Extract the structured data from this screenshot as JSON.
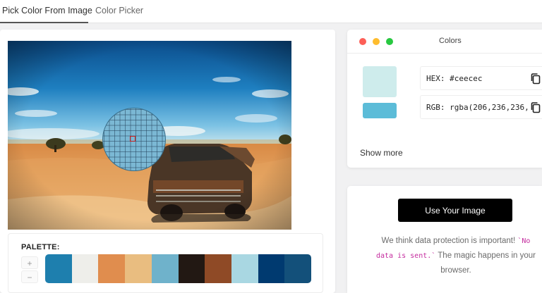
{
  "tabs": [
    {
      "label": "Pick Color From Image",
      "active": true
    },
    {
      "label": "Color Picker",
      "active": false
    }
  ],
  "palette": {
    "title": "PALETTE:",
    "zoom_in_label": "+",
    "zoom_out_label": "−",
    "swatches": [
      "#1e7fae",
      "#eeeeea",
      "#e08d4e",
      "#e9bd80",
      "#6fb2cb",
      "#221813",
      "#8f4a26",
      "#a9d7e2",
      "#003a70",
      "#13507a"
    ]
  },
  "colors_window": {
    "title": "Colors",
    "selected_color": "#ceecec",
    "secondary_color": "#5cbcd8",
    "hex_text": "HEX: #ceecec",
    "rgb_text": "RGB: rgba(206,236,236,",
    "show_more": "Show more",
    "traffic_light_colors": {
      "close": "#fd5f57",
      "minimize": "#febc2e",
      "maximize": "#28c840"
    }
  },
  "upload": {
    "button_label": "Use Your Image",
    "text_before": "We think data protection is important! ",
    "code_text": "`No data is sent.`",
    "text_after": " The magic happens in your browser."
  }
}
